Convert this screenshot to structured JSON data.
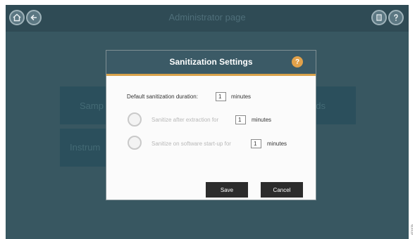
{
  "header": {
    "title": "Administrator page",
    "icons": [
      "home-icon",
      "back-icon",
      "manual-icon",
      "help-icon"
    ]
  },
  "tiles": [
    {
      "label": "Samp"
    },
    {
      "label": "ods"
    },
    {
      "label": "Instrum"
    }
  ],
  "dialog": {
    "title": "Sanitization Settings",
    "help_symbol": "?",
    "default_label": "Default sanitization duration:",
    "default_value": "1",
    "default_unit": "minutes",
    "after_extraction": {
      "label": "Sanitize after extraction for",
      "value": "1",
      "unit": "minutes",
      "selected": false
    },
    "on_startup": {
      "label": "Sanitize on software start-up for",
      "value": "1",
      "unit": "minutes",
      "selected": false
    },
    "save_label": "Save",
    "cancel_label": "Cancel"
  },
  "watermark": "ATXXTA",
  "colors": {
    "header": "#3b5a66",
    "accent": "#d9a24b",
    "background": "#3f616c"
  }
}
